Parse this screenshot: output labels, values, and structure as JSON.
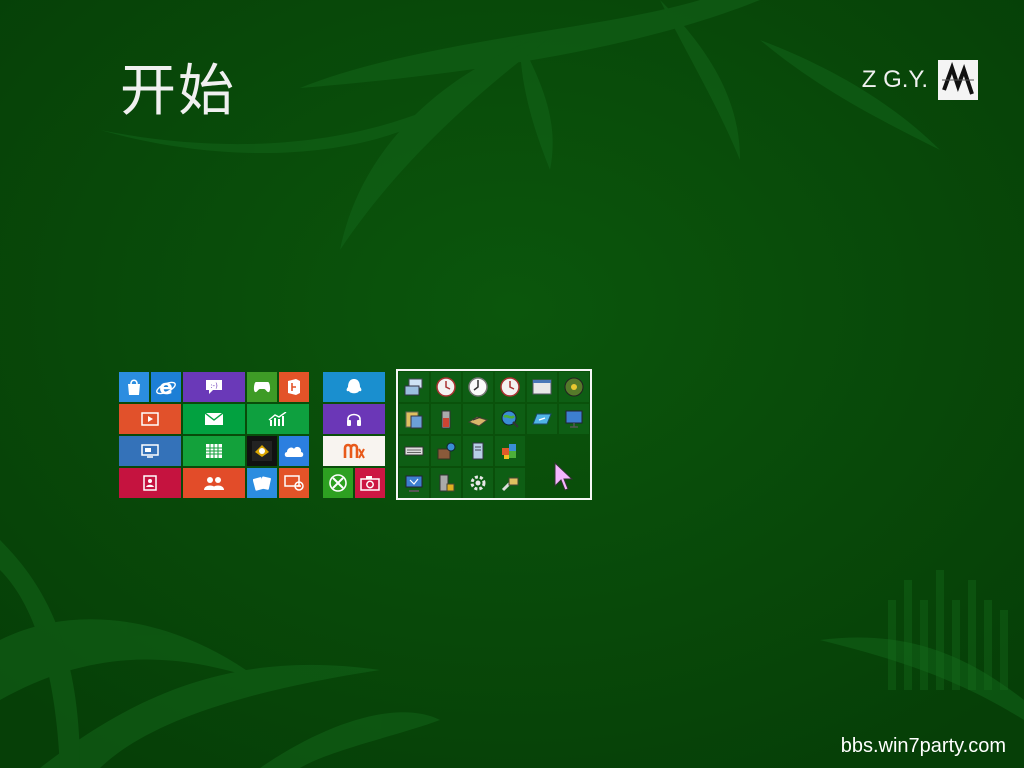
{
  "header": {
    "title": "开始"
  },
  "user": {
    "name": "Z G.Y."
  },
  "watermark": {
    "text": "bbs.win7party.com"
  },
  "colors": {
    "background": "#0a4a0a",
    "store": "#2b8de0",
    "ie": "#1d7fd6",
    "messaging": "#6a39b8",
    "games": "#3e9b26",
    "office": "#e35328",
    "video": "#e1512b",
    "mail": "#02a140",
    "finance": "#0ea03f",
    "remote": "#3472b9",
    "calendar": "#13a13b",
    "photos": "#c5133f",
    "people": "#e24c29",
    "qq": "#1a8fcf",
    "music": "#6b37b7",
    "mx": "#f8f4f0",
    "xbox": "#2da021",
    "camera": "#cc1743"
  },
  "tiles": [
    {
      "name": "store-tile",
      "icon": "shopping-bag-icon"
    },
    {
      "name": "internet-explorer-tile",
      "icon": "ie-icon"
    },
    {
      "name": "messaging-tile",
      "icon": "chat-bubble-icon"
    },
    {
      "name": "games-tile",
      "icon": "gamepad-icon"
    },
    {
      "name": "office-tile",
      "icon": "office-icon"
    },
    {
      "name": "video-tile",
      "icon": "play-icon"
    },
    {
      "name": "mail-tile",
      "icon": "envelope-icon"
    },
    {
      "name": "finance-tile",
      "icon": "chart-icon"
    },
    {
      "name": "remote-desktop-tile",
      "icon": "monitor-icon"
    },
    {
      "name": "calendar-tile",
      "icon": "grid-icon"
    },
    {
      "name": "media-tile",
      "icon": "media-icon"
    },
    {
      "name": "skydrive-tile",
      "icon": "cloud-icon"
    },
    {
      "name": "photos-tile",
      "icon": "photo-icon"
    },
    {
      "name": "people-tile",
      "icon": "people-icon"
    },
    {
      "name": "solitaire-tile",
      "icon": "cards-icon"
    },
    {
      "name": "desktop-connection-tile",
      "icon": "desktop-link-icon"
    },
    {
      "name": "qq-tile",
      "icon": "penguin-icon"
    },
    {
      "name": "music-tile",
      "icon": "headphones-icon"
    },
    {
      "name": "mx-tile",
      "icon": "mx-logo-icon"
    },
    {
      "name": "xbox-tile",
      "icon": "xbox-icon"
    },
    {
      "name": "camera-tile",
      "icon": "camera-icon"
    }
  ],
  "admin_tools": [
    "computer-icon",
    "clock-icon",
    "clock-icon",
    "clock-icon",
    "window-icon",
    "disc-icon",
    "folder-icon",
    "battery-icon",
    "drive-icon",
    "globe-icon",
    "network-icon",
    "display-icon",
    "keyboard-icon",
    "package-icon",
    "server-icon",
    "puzzle-icon",
    "monitor-icon",
    "lock-icon",
    "gear-icon",
    "tools-icon"
  ]
}
